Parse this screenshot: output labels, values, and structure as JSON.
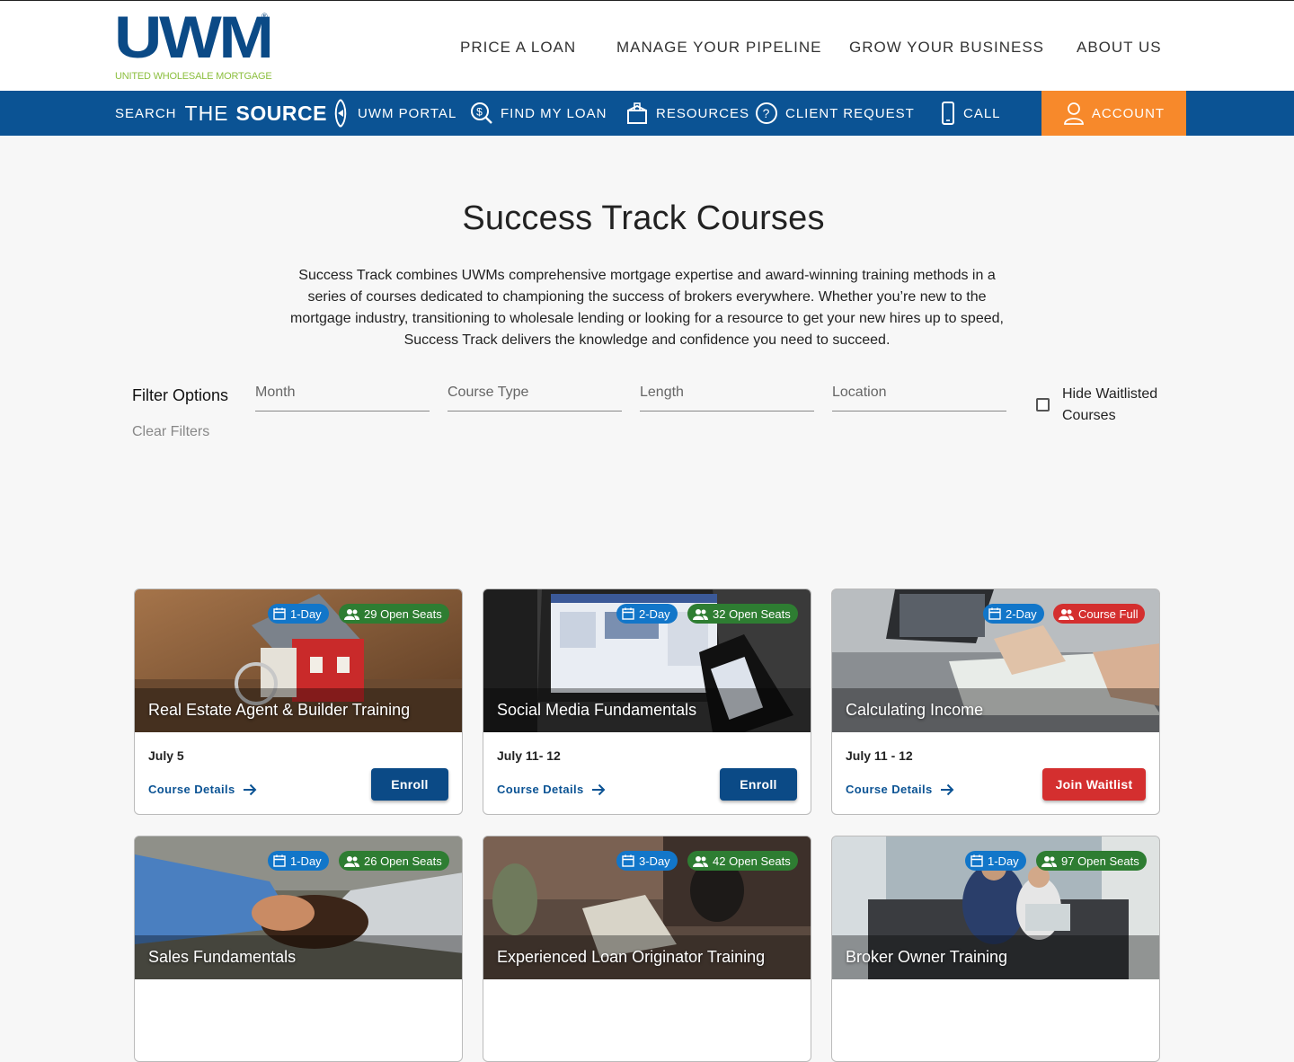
{
  "brand": {
    "logo_text": "UWM",
    "logo_sub": "UNITED WHOLESALE MORTGAGE",
    "reg": "®"
  },
  "top_nav": [
    "PRICE A LOAN",
    "MANAGE YOUR PIPELINE",
    "GROW YOUR BUSINESS",
    "ABOUT US"
  ],
  "bar": {
    "search_label": "SEARCH",
    "the": "THE",
    "source": "SOURCE",
    "portal": "UWM PORTAL",
    "find": "FIND MY LOAN",
    "resources": "RESOURCES",
    "client": "CLIENT REQUEST",
    "call": "CALL",
    "account": "ACCOUNT"
  },
  "page": {
    "title": "Success Track Courses",
    "intro": "Success Track combines UWMs comprehensive mortgage expertise and award-winning training methods in a series of courses dedicated to championing the success of brokers everywhere. Whether you’re new to the mortgage industry, transitioning to wholesale lending or looking for a resource to get your new hires up to speed, Success Track delivers the knowledge and confidence you need to succeed."
  },
  "filters": {
    "title": "Filter Options",
    "clear": "Clear Filters",
    "month": "Month",
    "course_type": "Course Type",
    "length": "Length",
    "location": "Location",
    "hide_waitlisted": "Hide Waitlisted Courses"
  },
  "colors": {
    "brand_blue": "#0b5394",
    "accent_orange": "#f7892b",
    "badge_blue": "#1276c9",
    "badge_green": "#2e7d32",
    "badge_red": "#d42f2f"
  },
  "courses": [
    {
      "title": "Real Estate Agent & Builder Training",
      "length": "1-Day",
      "seats": "29 Open Seats",
      "date": "July 5",
      "details": "Course Details",
      "action": "Enroll"
    },
    {
      "title": "Social Media Fundamentals",
      "length": "2-Day",
      "seats": "32 Open Seats",
      "date": "July 11- 12",
      "details": "Course Details",
      "action": "Enroll"
    },
    {
      "title": "Calculating Income",
      "length": "2-Day",
      "seats": "Course Full",
      "date": "July 11 - 12",
      "details": "Course Details",
      "action": "Join Waitlist"
    },
    {
      "title": "Sales Fundamentals",
      "length": "1-Day",
      "seats": "26 Open Seats"
    },
    {
      "title": "Experienced Loan Originator Training",
      "length": "3-Day",
      "seats": "42 Open Seats"
    },
    {
      "title": "Broker Owner Training",
      "length": "1-Day",
      "seats": "97 Open Seats"
    }
  ]
}
